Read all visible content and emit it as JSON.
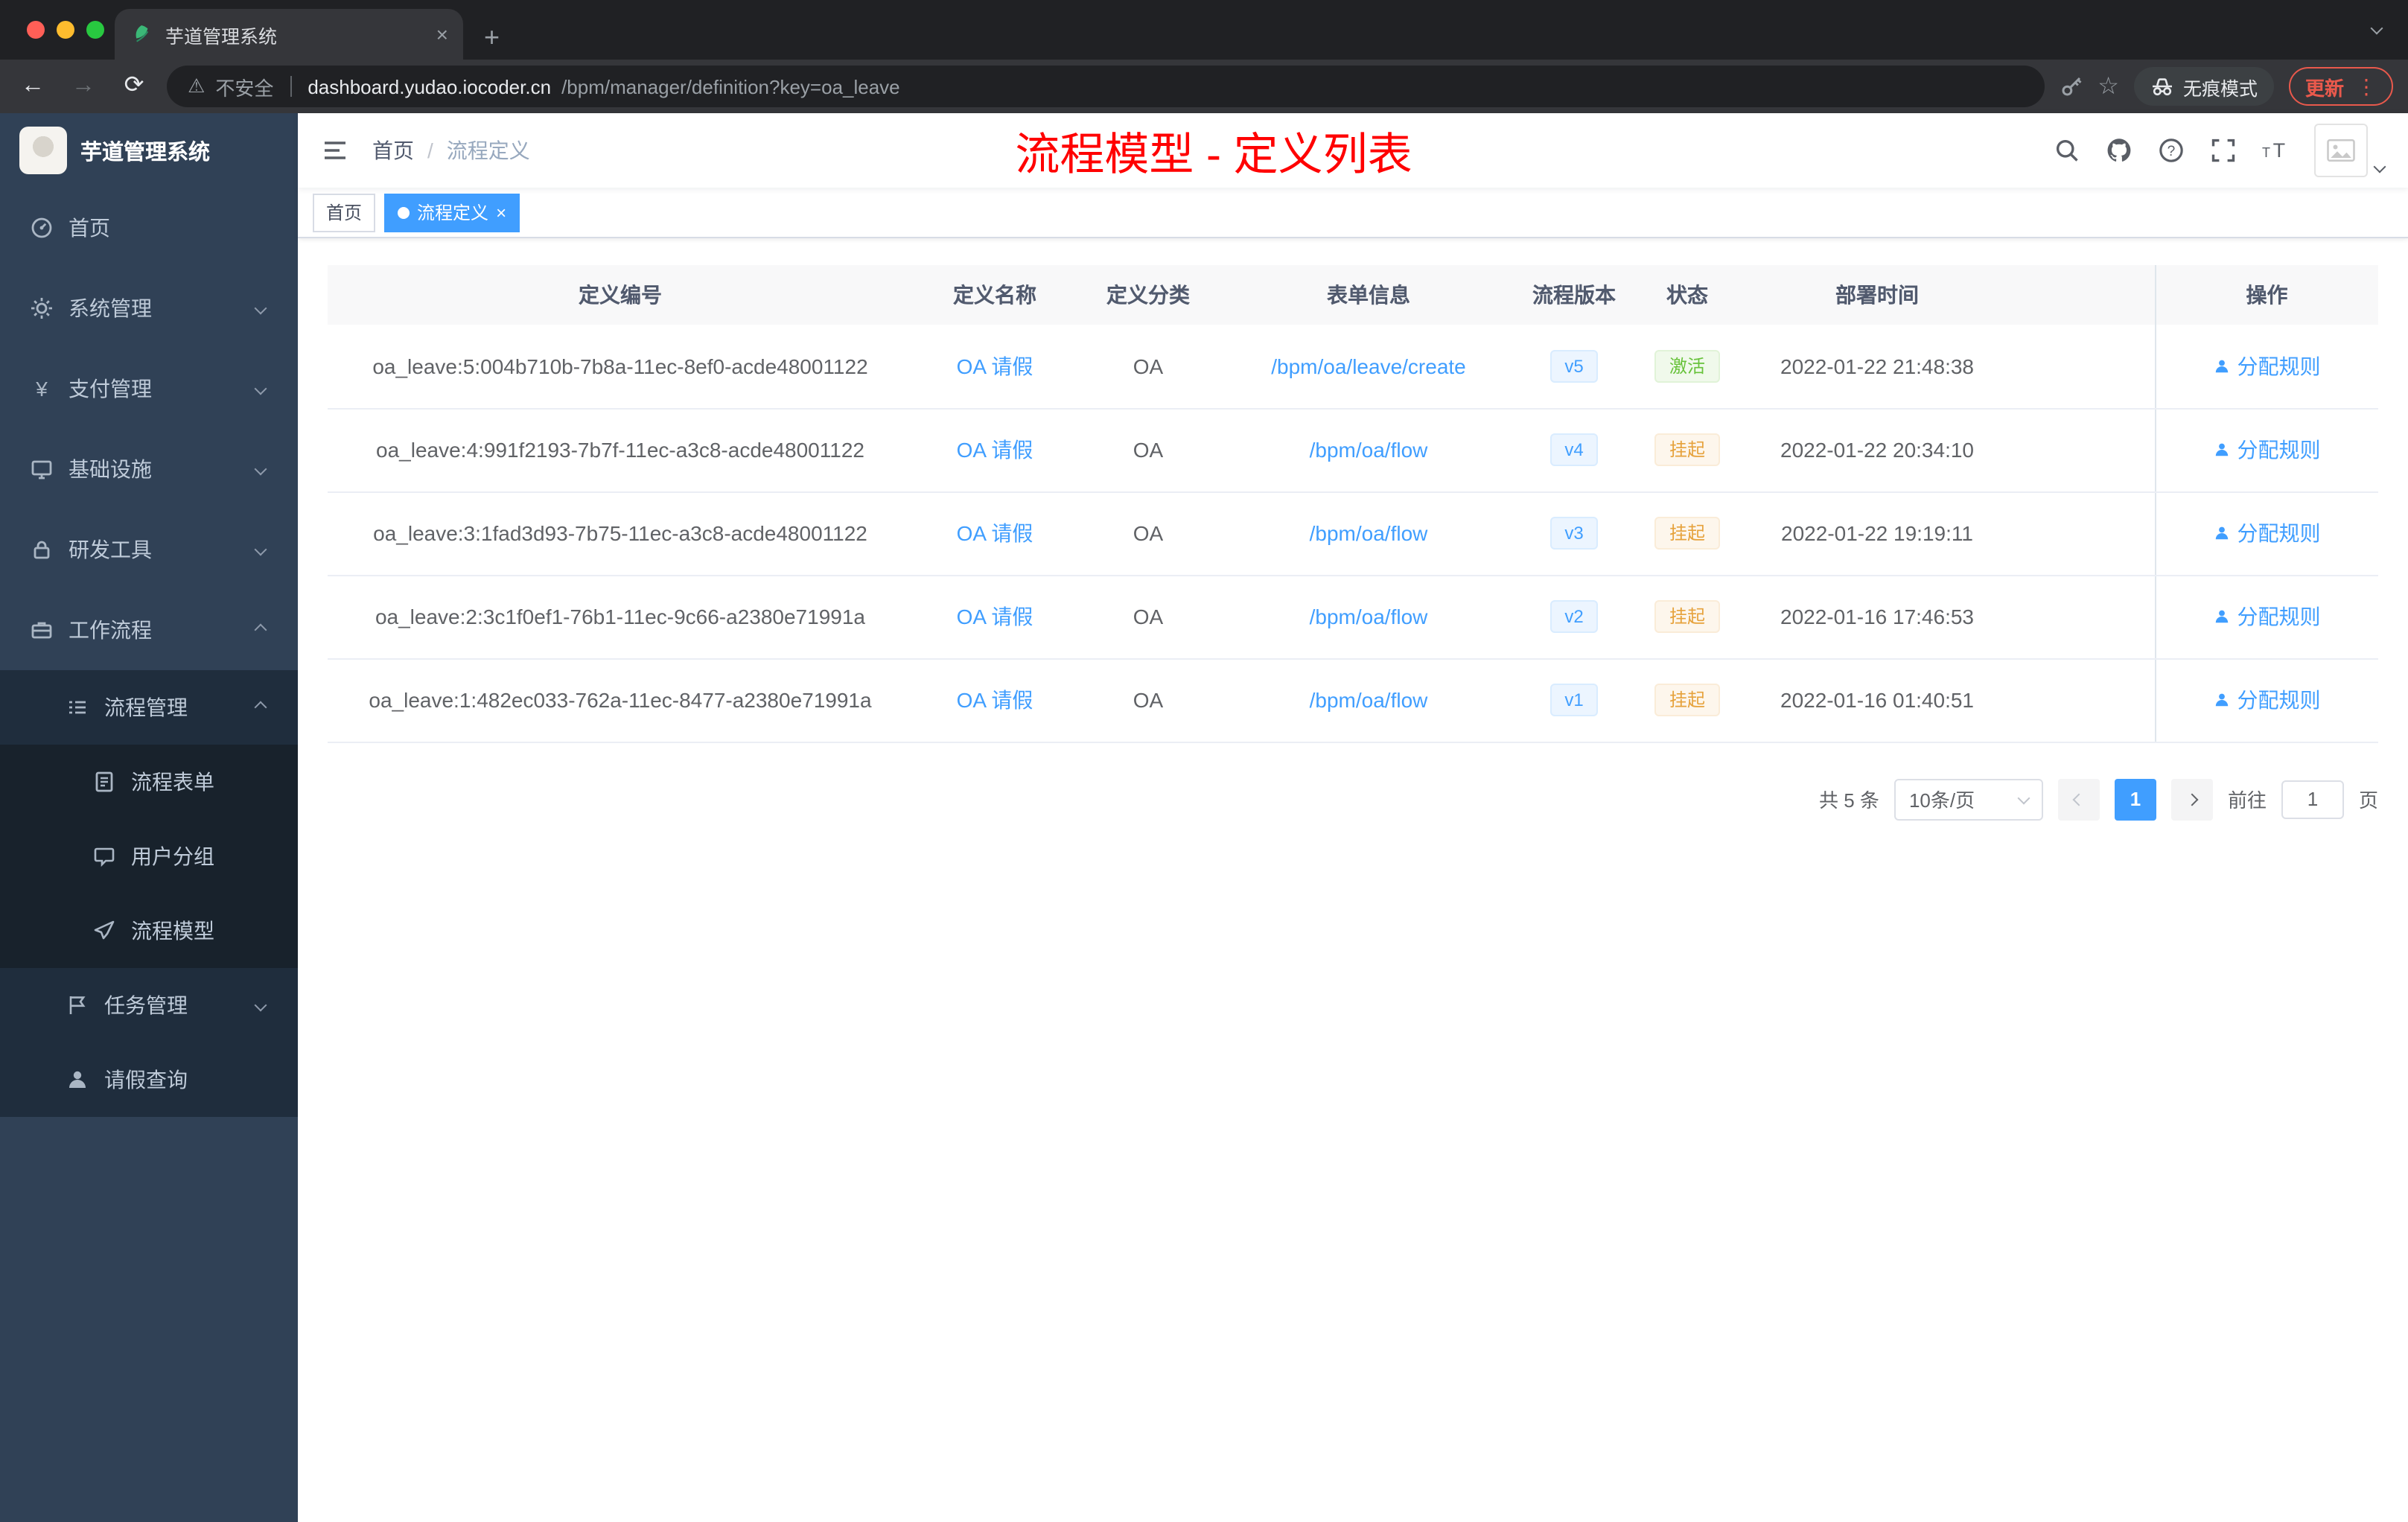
{
  "colors": {
    "accent": "#409eff",
    "title-red": "#ff0000",
    "sidebar-bg": "#304156",
    "submenu-bg": "#1f2d3d",
    "subsubmenu-bg": "#18222c",
    "success": "#67c23a",
    "warning": "#e6a23c",
    "update-red": "#e9594c"
  },
  "glyphs": {
    "close": "×",
    "plus": "+",
    "back": "←",
    "forward": "→",
    "reload": "⟳",
    "warning": "⚠",
    "star": "☆",
    "kebab": "⋮",
    "yen": "¥"
  },
  "browser": {
    "tab_title": "芋道管理系统",
    "security_label": "不安全",
    "url_domain": "dashboard.yudao.iocoder.cn",
    "url_path": "/bpm/manager/definition?key=oa_leave",
    "incognito_label": "无痕模式",
    "update_label": "更新"
  },
  "sidebar": {
    "logo_title": "芋道管理系统",
    "menu": [
      {
        "label": "首页"
      },
      {
        "label": "系统管理"
      },
      {
        "label": "支付管理"
      },
      {
        "label": "基础设施"
      },
      {
        "label": "研发工具"
      },
      {
        "label": "工作流程"
      },
      {
        "label": "流程管理"
      },
      {
        "label": "流程表单"
      },
      {
        "label": "用户分组"
      },
      {
        "label": "流程模型"
      },
      {
        "label": "任务管理"
      },
      {
        "label": "请假查询"
      }
    ]
  },
  "header": {
    "breadcrumb_home": "首页",
    "breadcrumb_sep": "/",
    "breadcrumb_current": "流程定义",
    "page_title": "流程模型 - 定义列表"
  },
  "tags": {
    "home": "首页",
    "active": "流程定义"
  },
  "table": {
    "columns": [
      "定义编号",
      "定义名称",
      "定义分类",
      "表单信息",
      "流程版本",
      "状态",
      "部署时间",
      "操作"
    ],
    "rows": [
      {
        "id": "oa_leave:5:004b710b-7b8a-11ec-8ef0-acde48001122",
        "name": "OA 请假",
        "category": "OA",
        "form": "/bpm/oa/leave/create",
        "version": "v5",
        "status": "激活",
        "status_type": "success",
        "deploy_time": "2022-01-22 21:48:38",
        "action": "分配规则"
      },
      {
        "id": "oa_leave:4:991f2193-7b7f-11ec-a3c8-acde48001122",
        "name": "OA 请假",
        "category": "OA",
        "form": "/bpm/oa/flow",
        "version": "v4",
        "status": "挂起",
        "status_type": "warning",
        "deploy_time": "2022-01-22 20:34:10",
        "action": "分配规则"
      },
      {
        "id": "oa_leave:3:1fad3d93-7b75-11ec-a3c8-acde48001122",
        "name": "OA 请假",
        "category": "OA",
        "form": "/bpm/oa/flow",
        "version": "v3",
        "status": "挂起",
        "status_type": "warning",
        "deploy_time": "2022-01-22 19:19:11",
        "action": "分配规则"
      },
      {
        "id": "oa_leave:2:3c1f0ef1-76b1-11ec-9c66-a2380e71991a",
        "name": "OA 请假",
        "category": "OA",
        "form": "/bpm/oa/flow",
        "version": "v2",
        "status": "挂起",
        "status_type": "warning",
        "deploy_time": "2022-01-16 17:46:53",
        "action": "分配规则"
      },
      {
        "id": "oa_leave:1:482ec033-762a-11ec-8477-a2380e71991a",
        "name": "OA 请假",
        "category": "OA",
        "form": "/bpm/oa/flow",
        "version": "v1",
        "status": "挂起",
        "status_type": "warning",
        "deploy_time": "2022-01-16 01:40:51",
        "action": "分配规则"
      }
    ]
  },
  "pagination": {
    "total": "共 5 条",
    "page_size": "10条/页",
    "current_page": "1",
    "goto_label": "前往",
    "goto_value": "1",
    "page_label": "页"
  }
}
